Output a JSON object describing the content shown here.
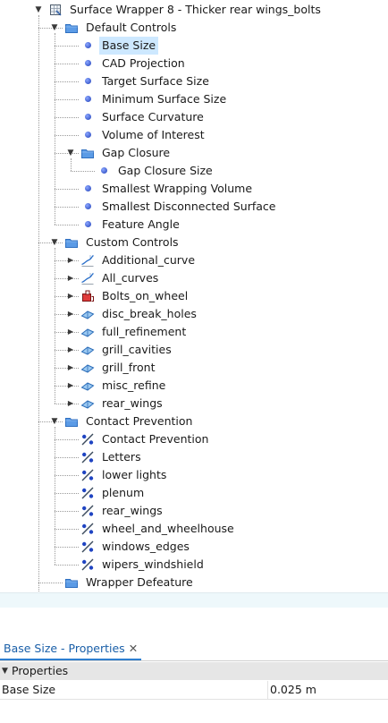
{
  "tree": [
    {
      "label": "Surface Wrapper 8 - Thicker rear wings_bolts",
      "depth": 0,
      "icon": "surface-wrapper-icon",
      "toggle": "expanded"
    },
    {
      "label": "Default Controls",
      "depth": 1,
      "icon": "folder-icon",
      "toggle": "expanded"
    },
    {
      "label": "Base Size",
      "depth": 2,
      "icon": "bullet-icon",
      "selected": true
    },
    {
      "label": "CAD Projection",
      "depth": 2,
      "icon": "bullet-icon"
    },
    {
      "label": "Target Surface Size",
      "depth": 2,
      "icon": "bullet-icon"
    },
    {
      "label": "Minimum Surface Size",
      "depth": 2,
      "icon": "bullet-icon"
    },
    {
      "label": "Surface Curvature",
      "depth": 2,
      "icon": "bullet-icon"
    },
    {
      "label": "Volume of Interest",
      "depth": 2,
      "icon": "bullet-icon"
    },
    {
      "label": "Gap Closure",
      "depth": 2,
      "icon": "folder-icon",
      "toggle": "expanded"
    },
    {
      "label": "Gap Closure Size",
      "depth": 3,
      "icon": "bullet-icon"
    },
    {
      "label": "Smallest Wrapping Volume",
      "depth": 2,
      "icon": "bullet-icon"
    },
    {
      "label": "Smallest Disconnected Surface",
      "depth": 2,
      "icon": "bullet-icon"
    },
    {
      "label": "Feature Angle",
      "depth": 2,
      "icon": "bullet-icon"
    },
    {
      "label": "Custom Controls",
      "depth": 1,
      "icon": "folder-icon",
      "toggle": "expanded"
    },
    {
      "label": "Additional_curve",
      "depth": 2,
      "icon": "curve-control-icon",
      "toggle": "collapsed"
    },
    {
      "label": "All_curves",
      "depth": 2,
      "icon": "curve-control-icon",
      "toggle": "collapsed"
    },
    {
      "label": "Bolts_on_wheel",
      "depth": 2,
      "icon": "volume-control-icon",
      "toggle": "collapsed"
    },
    {
      "label": "disc_break_holes",
      "depth": 2,
      "icon": "surface-control-icon",
      "toggle": "collapsed"
    },
    {
      "label": "full_refinement",
      "depth": 2,
      "icon": "surface-control-icon",
      "toggle": "collapsed"
    },
    {
      "label": "grill_cavities",
      "depth": 2,
      "icon": "surface-control-icon",
      "toggle": "collapsed"
    },
    {
      "label": "grill_front",
      "depth": 2,
      "icon": "surface-control-icon",
      "toggle": "collapsed"
    },
    {
      "label": "misc_refine",
      "depth": 2,
      "icon": "surface-control-icon",
      "toggle": "collapsed"
    },
    {
      "label": "rear_wings",
      "depth": 2,
      "icon": "surface-control-icon",
      "toggle": "collapsed"
    },
    {
      "label": "Contact Prevention",
      "depth": 1,
      "icon": "folder-icon",
      "toggle": "expanded"
    },
    {
      "label": "Contact Prevention",
      "depth": 2,
      "icon": "contact-prevention-icon"
    },
    {
      "label": "Letters",
      "depth": 2,
      "icon": "contact-prevention-icon"
    },
    {
      "label": "lower lights",
      "depth": 2,
      "icon": "contact-prevention-icon"
    },
    {
      "label": "plenum",
      "depth": 2,
      "icon": "contact-prevention-icon"
    },
    {
      "label": "rear_wings",
      "depth": 2,
      "icon": "contact-prevention-icon"
    },
    {
      "label": "wheel_and_wheelhouse",
      "depth": 2,
      "icon": "contact-prevention-icon"
    },
    {
      "label": "windows_edges",
      "depth": 2,
      "icon": "contact-prevention-icon"
    },
    {
      "label": "wipers_windshield",
      "depth": 2,
      "icon": "contact-prevention-icon"
    },
    {
      "label": "Wrapper Defeature",
      "depth": 1,
      "icon": "folder-icon"
    }
  ],
  "properties_panel": {
    "tab_label": "Base Size - Properties",
    "close_glyph": "✕",
    "section_label": "Properties",
    "rows": [
      {
        "name": "Base Size",
        "value": "0.025 m"
      }
    ]
  },
  "colors": {
    "selection": "#cde8ff",
    "folder": "#3f84d6",
    "bullet": "#2747c4",
    "tab_accent": "#2d7fd1"
  }
}
